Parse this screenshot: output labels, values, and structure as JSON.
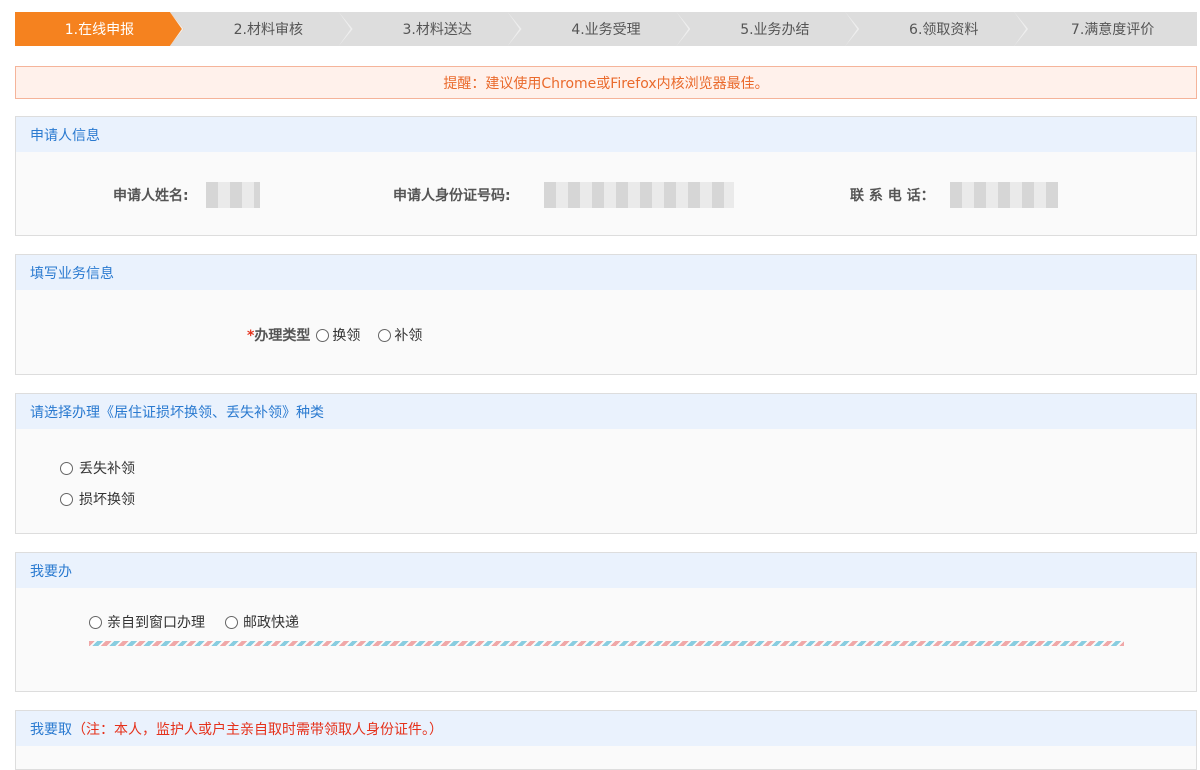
{
  "steps": [
    "1.在线申报",
    "2.材料审核",
    "3.材料送达",
    "4.业务受理",
    "5.业务办结",
    "6.领取资料",
    "7.满意度评价"
  ],
  "notice": "提醒：建议使用Chrome或Firefox内核浏览器最佳。",
  "applicant": {
    "title": "申请人信息",
    "name_label": "申请人姓名:",
    "id_label": "申请人身份证号码:",
    "phone_label": "联 系 电 话："
  },
  "business": {
    "title": "填写业务信息",
    "required": "*",
    "type_label": "办理类型",
    "options": [
      "换领",
      "补领"
    ]
  },
  "category": {
    "title": "请选择办理《居住证损坏换领、丢失补领》种类",
    "options": [
      "丢失补领",
      "损坏换领"
    ]
  },
  "handle": {
    "title": "我要办",
    "options": [
      "亲自到窗口办理",
      "邮政快递"
    ]
  },
  "collect": {
    "title": "我要取",
    "note": "（注：本人，监护人或户主亲自取时需带领取人身份证件。）"
  }
}
